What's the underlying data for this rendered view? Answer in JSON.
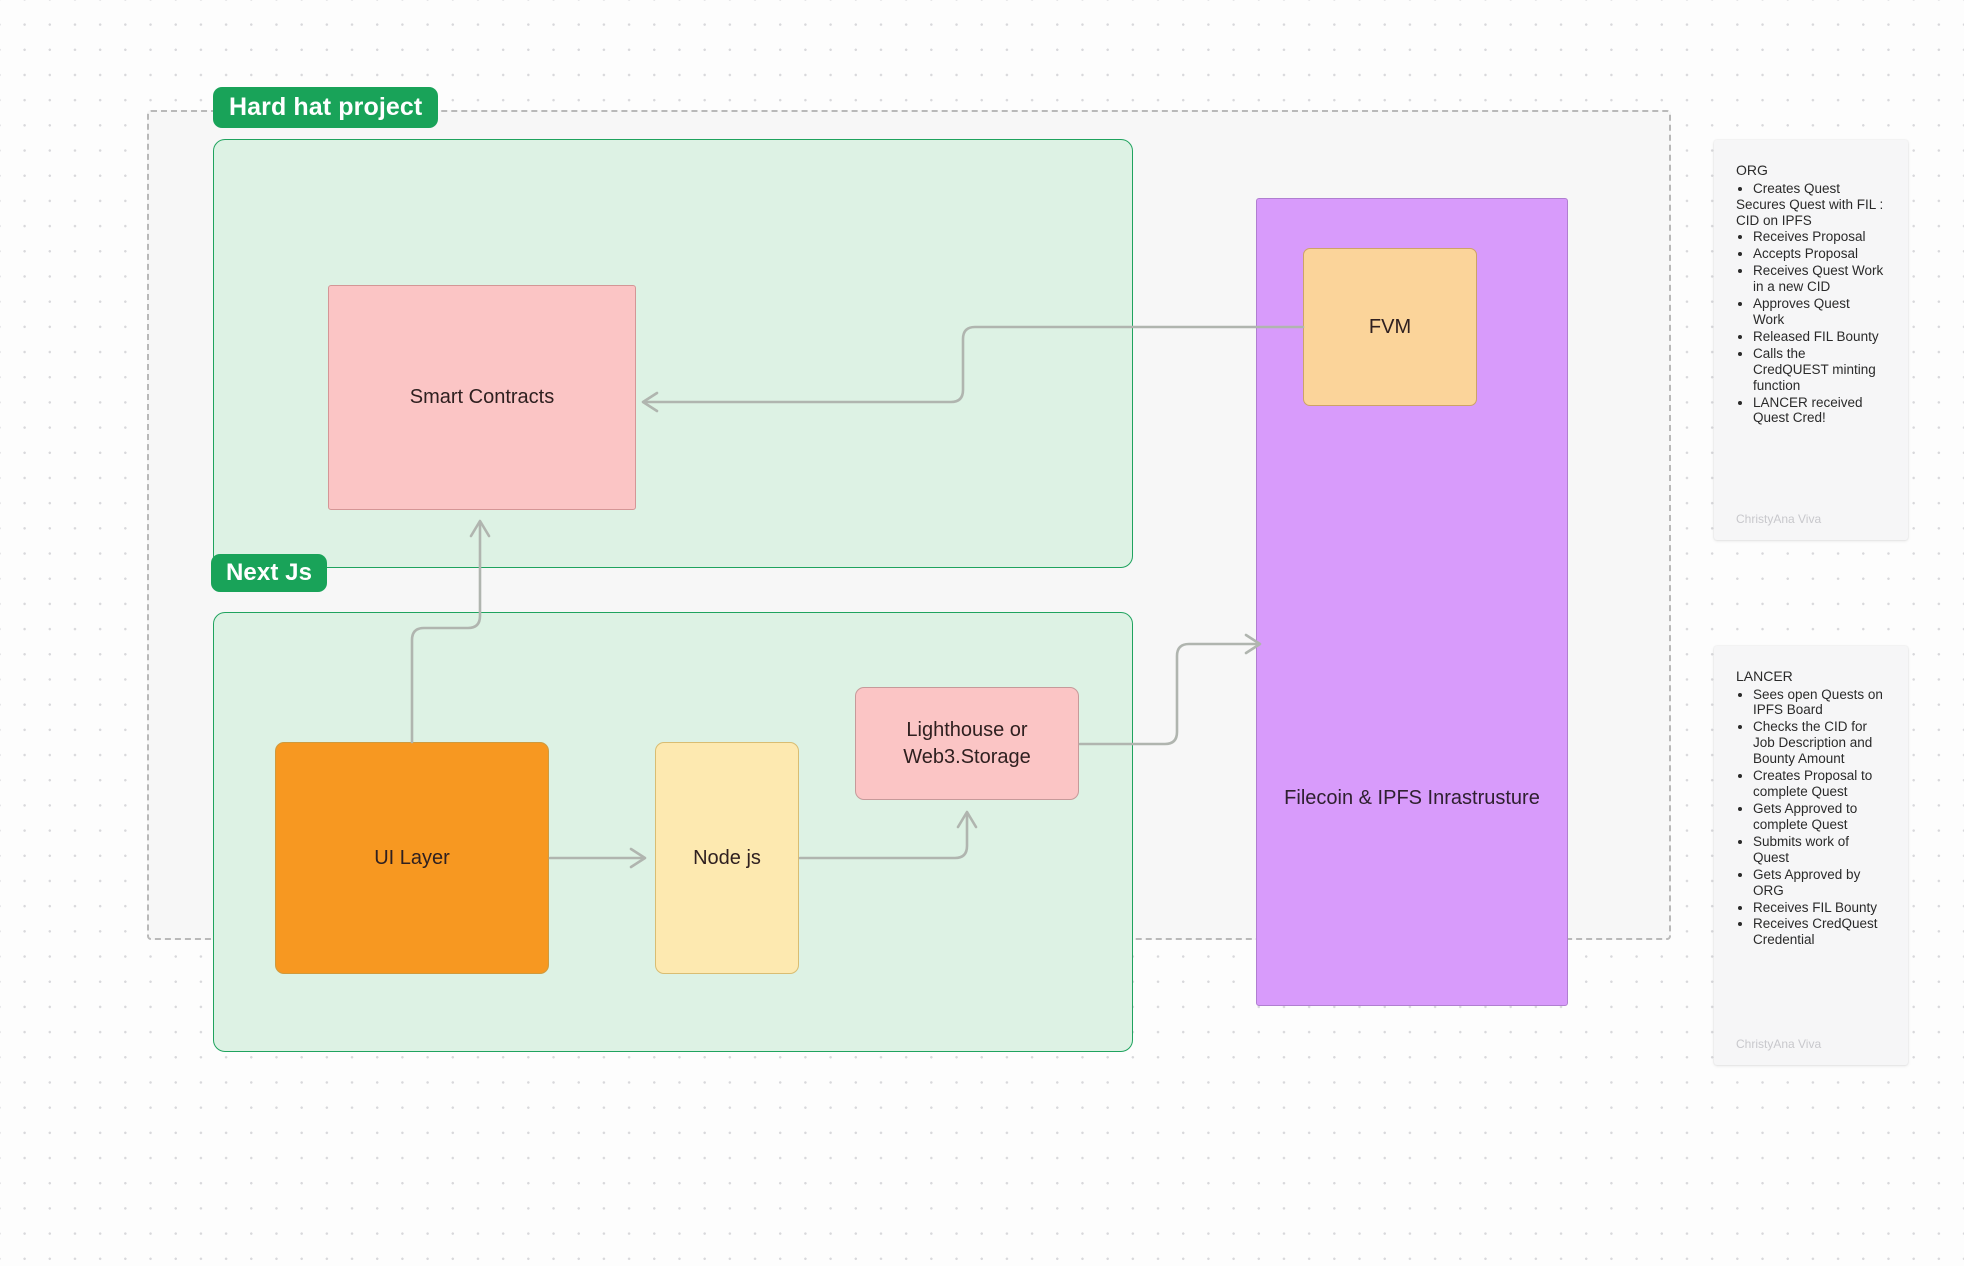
{
  "canvas": {
    "background_color": "#fdfdfd",
    "dot_color": "#d8d8db"
  },
  "frames": {
    "hardhat": {
      "badge_label": "Hard hat project",
      "badge_color": "#19a359",
      "border_style": "dashed",
      "border_color": "#b9b9b9"
    },
    "nextjs": {
      "badge_label": "Next Js",
      "badge_color": "#19a359"
    }
  },
  "groups": {
    "contracts_group": {
      "fill": "#ddf2e4",
      "border": "#1fa35e"
    },
    "frontend_group": {
      "fill": "#ddf2e4",
      "border": "#1fa35e"
    }
  },
  "nodes": {
    "smart_contracts": {
      "label": "Smart Contracts",
      "fill": "#fbc5c5"
    },
    "ui_layer": {
      "label": "UI Layer",
      "fill": "#f79821"
    },
    "node_js": {
      "label": "Node js",
      "fill": "#fde9b0"
    },
    "lighthouse": {
      "label": "Lighthouse or\nWeb3.Storage",
      "line1": "Lighthouse or",
      "line2": "Web3.Storage",
      "fill": "#fbc5c5"
    },
    "filecoin": {
      "label": "Filecoin & IPFS Inrastrusture",
      "fill": "#d89bfb"
    },
    "fvm": {
      "label": "FVM",
      "fill": "#fbd49a"
    }
  },
  "edges": [
    {
      "from": "fvm",
      "to": "smart_contracts",
      "style": "orthogonal-rounded",
      "color": "#b0b5af"
    },
    {
      "from": "ui_layer",
      "to": "smart_contracts",
      "style": "orthogonal-rounded",
      "color": "#b0b5af"
    },
    {
      "from": "ui_layer",
      "to": "node_js",
      "style": "straight",
      "color": "#b0b5af"
    },
    {
      "from": "node_js",
      "to": "lighthouse",
      "style": "orthogonal-rounded",
      "color": "#b0b5af"
    },
    {
      "from": "lighthouse",
      "to": "filecoin",
      "style": "orthogonal-rounded",
      "color": "#b0b5af"
    }
  ],
  "notes": {
    "org": {
      "title": "ORG",
      "items_a": [
        "Creates Quest"
      ],
      "free_lines": [
        "Secures Quest with FIL :",
        "CID on IPFS"
      ],
      "items_b": [
        "Receives Proposal",
        "Accepts Proposal",
        "Receives Quest Work in a new CID",
        "Approves Quest Work",
        "Released FIL Bounty",
        "Calls the CredQUEST minting function",
        "LANCER received Quest Cred!"
      ],
      "author": "ChristyAna Viva"
    },
    "lancer": {
      "title": "LANCER",
      "items": [
        "Sees open Quests on IPFS Board",
        "Checks the CID for Job Description and Bounty Amount",
        "Creates Proposal to complete Quest",
        "Gets Approved to complete Quest",
        "Submits work of Quest",
        "Gets Approved by ORG",
        "Receives FIL Bounty",
        "Receives CredQuest Credential"
      ],
      "author": "ChristyAna Viva"
    }
  }
}
